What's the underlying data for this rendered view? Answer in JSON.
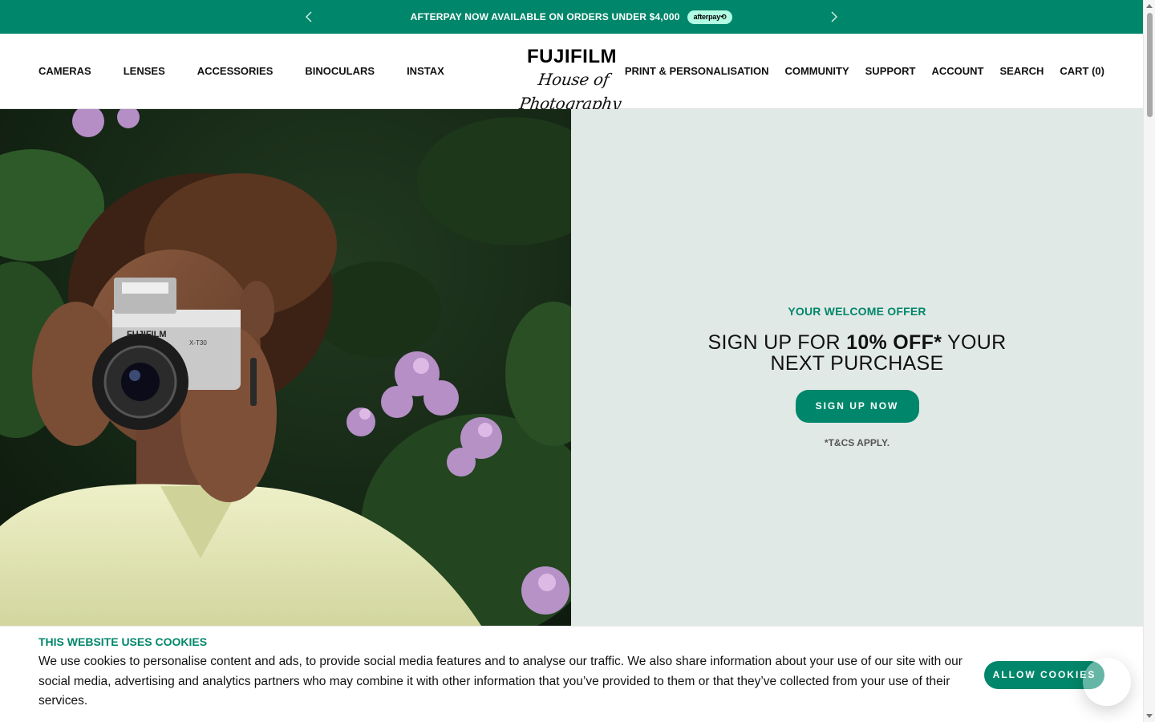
{
  "announcement": {
    "message": "AFTERPAY NOW AVAILABLE ON ORDERS UNDER $4,000",
    "badge": "afterpay⟲",
    "prev_icon": "chevron-left-icon",
    "next_icon": "chevron-right-icon"
  },
  "header": {
    "nav_left": [
      "CAMERAS",
      "LENSES",
      "ACCESSORIES",
      "BINOCULARS",
      "INSTAX"
    ],
    "logo_brand": "FUJIFILM",
    "logo_script": "House of Photography",
    "nav_right": [
      "PRINT & PERSONALISATION",
      "COMMUNITY",
      "SUPPORT",
      "ACCOUNT",
      "SEARCH",
      "CART (0)"
    ]
  },
  "hero": {
    "image_icon": "woman-with-camera-photo",
    "kicker": "YOUR WELCOME OFFER",
    "headline_pre": "SIGN UP FOR ",
    "headline_bold": "10% OFF*",
    "headline_post": " YOUR NEXT PURCHASE",
    "cta": "SIGN UP NOW",
    "terms": "*T&CS APPLY."
  },
  "cookie": {
    "title": "THIS WEBSITE USES COOKIES",
    "text": "We use cookies to personalise content and ads, to provide social media features and to analyse our traffic. We also share information about your use of our site with our social media, advertising and analytics partners who may combine it with other information that you’ve provided to them or that they’ve collected from your use of their services.",
    "button": "ALLOW COOKIES"
  },
  "colors": {
    "accent": "#00866a",
    "panel": "#e1e9e6",
    "badge": "#b2fce4"
  }
}
